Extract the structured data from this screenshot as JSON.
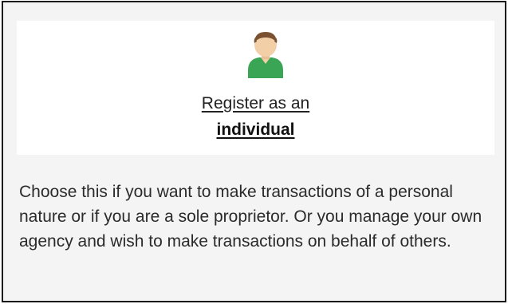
{
  "option": {
    "icon": "user-avatar-icon",
    "title_prefix": "Register as an",
    "title_emphasis": "individual",
    "description": "Choose this if you want to make transactions of a personal nature or if you are a sole proprietor. Or you manage your own agency and wish to make transactions on behalf of others."
  },
  "colors": {
    "card_background": "#f4f4f4",
    "card_border": "#1b1b1b",
    "option_background": "#ffffff",
    "avatar_shirt": "#3aa655",
    "avatar_skin": "#f3cfa8",
    "avatar_hair": "#7a5232"
  }
}
